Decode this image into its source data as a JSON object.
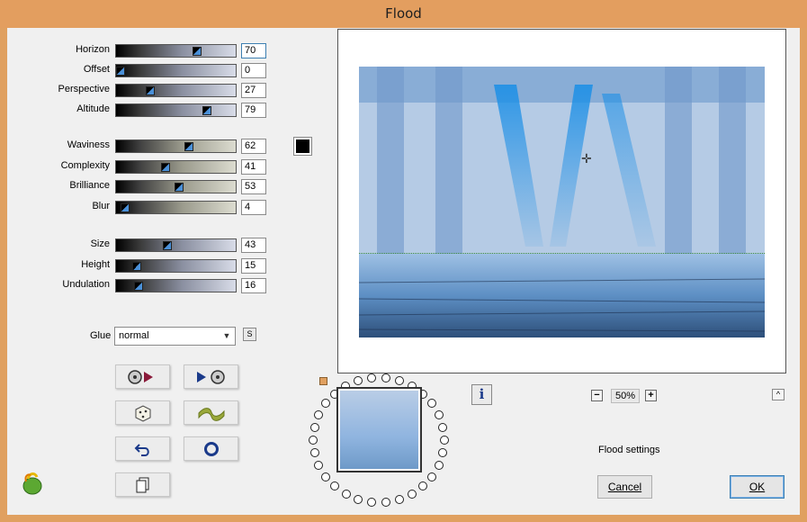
{
  "window": {
    "title": "Flood"
  },
  "sliders": [
    {
      "key": "horizon",
      "label": "Horizon",
      "value": "70",
      "level": 70,
      "track": "blue",
      "focus": true
    },
    {
      "key": "offset",
      "label": "Offset",
      "value": "0",
      "level": 0,
      "track": "blue"
    },
    {
      "key": "perspective",
      "label": "Perspective",
      "value": "27",
      "level": 27,
      "track": "blue"
    },
    {
      "key": "altitude",
      "label": "Altitude",
      "value": "79",
      "level": 79,
      "track": "blue"
    },
    {
      "key": "waviness",
      "label": "Waviness",
      "value": "62",
      "level": 62,
      "track": "khaki"
    },
    {
      "key": "complexity",
      "label": "Complexity",
      "value": "41",
      "level": 41,
      "track": "khaki"
    },
    {
      "key": "brilliance",
      "label": "Brilliance",
      "value": "53",
      "level": 53,
      "track": "khaki"
    },
    {
      "key": "blur",
      "label": "Blur",
      "value": "4",
      "level": 4,
      "track": "khaki"
    },
    {
      "key": "size",
      "label": "Size",
      "value": "43",
      "level": 43,
      "track": "blue"
    },
    {
      "key": "height",
      "label": "Height",
      "value": "15",
      "level": 15,
      "track": "blue"
    },
    {
      "key": "undulation",
      "label": "Undulation",
      "value": "16",
      "level": 16,
      "track": "blue"
    }
  ],
  "color_swatch": {
    "color": "#000000"
  },
  "glue": {
    "label": "Glue",
    "value": "normal",
    "s_button": "S"
  },
  "tool_buttons": [
    {
      "key": "load-preset",
      "icon": "disc-play-icon"
    },
    {
      "key": "save-preset",
      "icon": "play-disc-icon"
    },
    {
      "key": "randomize",
      "icon": "dice-icon"
    },
    {
      "key": "wave",
      "icon": "wave-icon"
    },
    {
      "key": "undo",
      "icon": "undo-icon"
    },
    {
      "key": "reset",
      "icon": "ring-icon"
    },
    {
      "key": "copy",
      "icon": "copy-icon"
    }
  ],
  "zoom": {
    "value": "50%",
    "minus": "−",
    "plus": "+"
  },
  "collapse_label": "^",
  "info_label": "i",
  "status": {
    "settings_label": "Flood settings"
  },
  "buttons": {
    "cancel_label": "Cancel",
    "ok_label": "OK"
  }
}
